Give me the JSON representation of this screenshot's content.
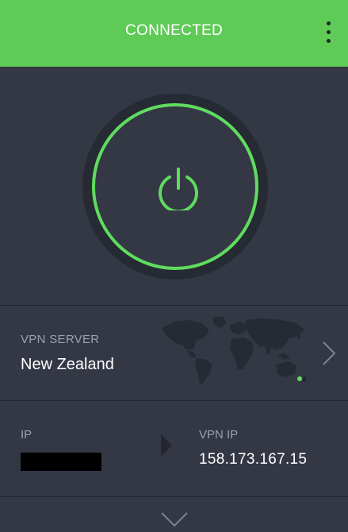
{
  "header": {
    "status": "CONNECTED",
    "menu_icon": "more-vertical-icon"
  },
  "power": {
    "icon": "power-icon",
    "state": "on"
  },
  "server": {
    "label": "VPN SERVER",
    "value": "New Zealand",
    "map_icon": "world-map",
    "nav_icon": "chevron-right-icon"
  },
  "ip": {
    "label": "IP",
    "value_redacted": true,
    "arrow_icon": "arrow-right-icon",
    "vpn_label": "VPN IP",
    "vpn_value": "158.173.167.15"
  },
  "footer": {
    "expand_icon": "chevron-down-icon"
  },
  "colors": {
    "accent": "#5fcb57",
    "power_ring": "#5fdc5f",
    "background": "#343845",
    "muted_text": "#9ca1ad"
  }
}
